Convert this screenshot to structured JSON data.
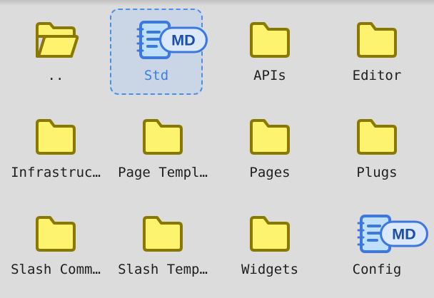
{
  "colors": {
    "background": "#dcdcdc",
    "folder_fill": "#fdf36f",
    "folder_stroke": "#8a7800",
    "doc_fill": "#bfe0fb",
    "doc_stroke": "#3d78e0",
    "selection": "#4a90e2",
    "selected_label": "#3b82e0"
  },
  "items": [
    {
      "label": "..",
      "icon": "open-folder-icon",
      "selected": false
    },
    {
      "label": "Std",
      "icon": "markdown-doc-icon",
      "badge": "MD",
      "selected": true
    },
    {
      "label": "APIs",
      "icon": "folder-icon",
      "selected": false
    },
    {
      "label": "Editor",
      "icon": "folder-icon",
      "selected": false
    },
    {
      "label": "Infrastruc…",
      "icon": "folder-icon",
      "selected": false
    },
    {
      "label": "Page Templ…",
      "icon": "folder-icon",
      "selected": false
    },
    {
      "label": "Pages",
      "icon": "folder-icon",
      "selected": false
    },
    {
      "label": "Plugs",
      "icon": "folder-icon",
      "selected": false
    },
    {
      "label": "Slash Comm…",
      "icon": "folder-icon",
      "selected": false
    },
    {
      "label": "Slash Temp…",
      "icon": "folder-icon",
      "selected": false
    },
    {
      "label": "Widgets",
      "icon": "folder-icon",
      "selected": false
    },
    {
      "label": "Config",
      "icon": "markdown-doc-icon",
      "badge": "MD",
      "selected": false
    }
  ]
}
